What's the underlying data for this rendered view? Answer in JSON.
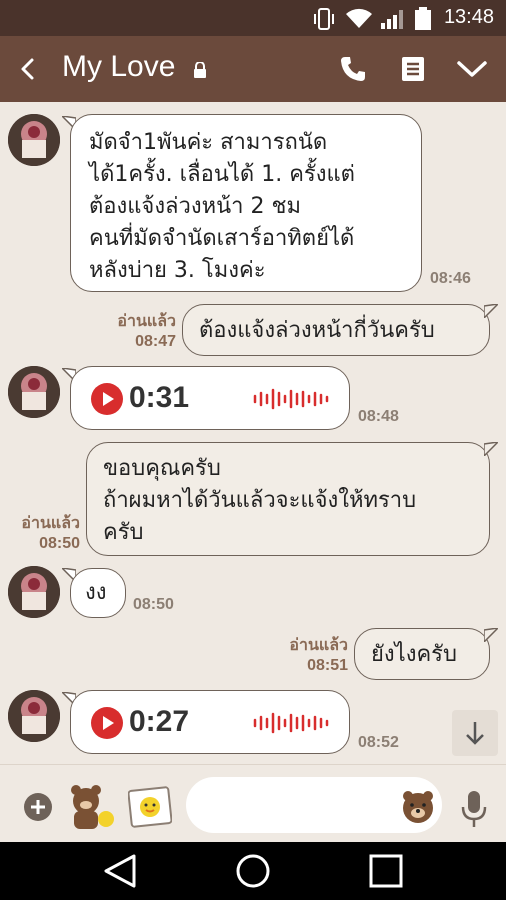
{
  "status_bar": {
    "time": "13:48"
  },
  "header": {
    "title": "My Love"
  },
  "messages": [
    {
      "side": "in",
      "text": "มัดจำ1พันค่ะ สามารถนัด\nได้1ครั้ง. เลื่อนได้ 1. ครั้งแต่\nต้องแจ้งล่วงหน้า 2 ชม\nคนที่มัดจำนัดเสาร์อาทิตย์ได้\nหลังบ่าย 3. โมงค่ะ",
      "time": "08:46"
    },
    {
      "side": "out",
      "text": "ต้องแจ้งล่วงหน้ากี่วันครับ",
      "read": "อ่านแล้ว",
      "time": "08:47"
    },
    {
      "side": "in",
      "voice_duration": "0:31",
      "time": "08:48"
    },
    {
      "side": "out",
      "text": "ขอบคุณครับ\nถ้าผมหาได้วันแล้วจะแจ้งให้ทราบ\nครับ",
      "read": "อ่านแล้ว",
      "time": "08:50"
    },
    {
      "side": "in",
      "text": "งง",
      "time": "08:50"
    },
    {
      "side": "out",
      "text": "ยังไงครับ",
      "read": "อ่านแล้ว",
      "time": "08:51"
    },
    {
      "side": "in",
      "voice_duration": "0:27",
      "time": "08:52"
    }
  ],
  "input": {
    "placeholder": ""
  },
  "colors": {
    "header": "#6b4a3c",
    "status_bar": "#4a332b",
    "chat_bg": "#efe9e2",
    "voice_red": "#d82d2d"
  },
  "icons": [
    "back-icon",
    "lock-icon",
    "call-icon",
    "notes-icon",
    "chevron-down-icon",
    "play-icon",
    "waveform-icon",
    "arrow-down-icon",
    "plus-icon",
    "sticker-icon",
    "photo-icon",
    "emoji-icon",
    "mic-icon"
  ]
}
